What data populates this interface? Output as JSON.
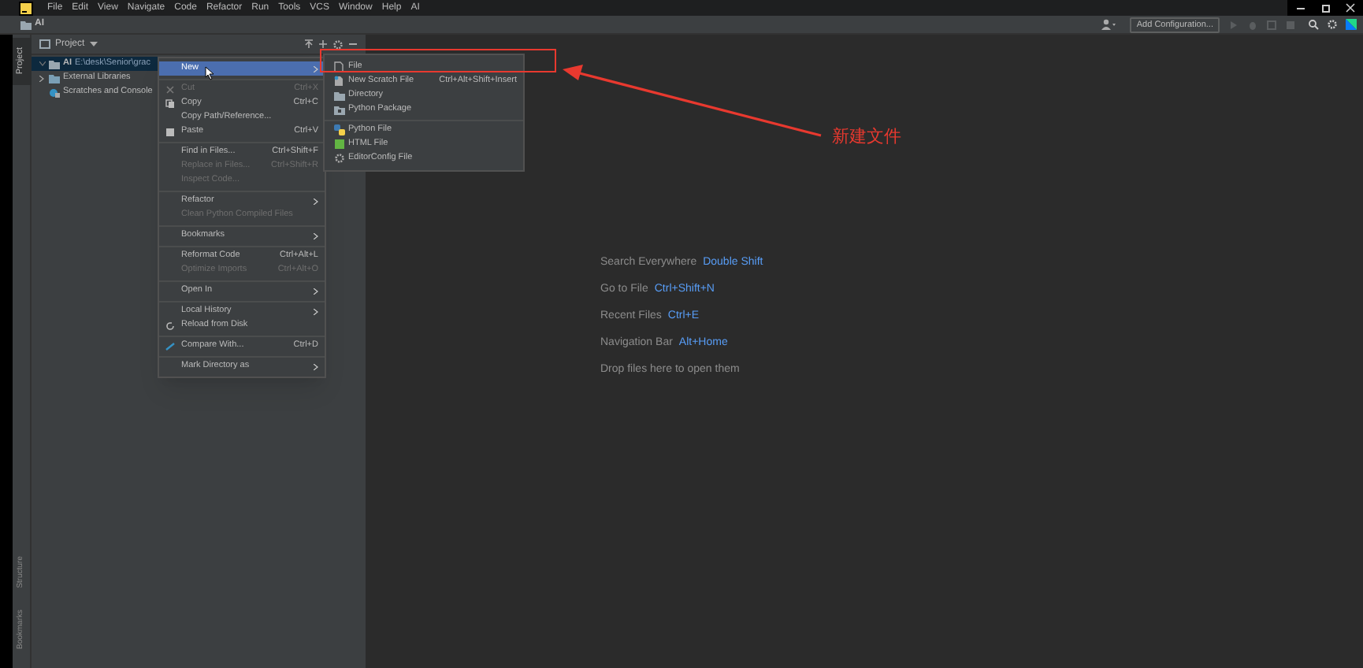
{
  "menu_bar": [
    "File",
    "Edit",
    "View",
    "Navigate",
    "Code",
    "Refactor",
    "Run",
    "Tools",
    "VCS",
    "Window",
    "Help",
    "AI"
  ],
  "navigation_bar": {
    "crumb": "AI"
  },
  "toolbar": {
    "run_configuration": "Add Configuration..."
  },
  "side_tabs": {
    "top": "Project",
    "bottom": [
      "Structure",
      "Bookmarks"
    ]
  },
  "project_panel": {
    "title": "Project",
    "tree": [
      {
        "label": "AI",
        "path": "E:\\desk\\Senior\\grac",
        "selected": true,
        "expanded": true
      },
      {
        "label": "External Libraries",
        "selected": false,
        "expanded": false
      },
      {
        "label": "Scratches and Console",
        "selected": false
      }
    ]
  },
  "context_menu": [
    {
      "kind": "item",
      "label": "New",
      "selected": true,
      "submenu": true,
      "disabled": false
    },
    {
      "kind": "separator"
    },
    {
      "kind": "item",
      "label": "Cut",
      "shortcut": "Ctrl+X",
      "selected": false,
      "disabled": true
    },
    {
      "kind": "item",
      "label": "Copy",
      "shortcut": "Ctrl+C",
      "selected": false,
      "disabled": false
    },
    {
      "kind": "item",
      "label": "Copy Path/Reference...",
      "selected": false,
      "disabled": false
    },
    {
      "kind": "item",
      "label": "Paste",
      "shortcut": "Ctrl+V",
      "selected": false,
      "disabled": false
    },
    {
      "kind": "separator"
    },
    {
      "kind": "item",
      "label": "Find in Files...",
      "shortcut": "Ctrl+Shift+F",
      "selected": false,
      "disabled": false
    },
    {
      "kind": "item",
      "label": "Replace in Files...",
      "shortcut": "Ctrl+Shift+R",
      "selected": false,
      "disabled": true
    },
    {
      "kind": "item",
      "label": "Inspect Code...",
      "selected": false,
      "disabled": true
    },
    {
      "kind": "separator"
    },
    {
      "kind": "item",
      "label": "Refactor",
      "submenu": true,
      "selected": false,
      "disabled": false
    },
    {
      "kind": "item",
      "label": "Clean Python Compiled Files",
      "selected": false,
      "disabled": true
    },
    {
      "kind": "separator"
    },
    {
      "kind": "item",
      "label": "Bookmarks",
      "submenu": true,
      "selected": false,
      "disabled": false
    },
    {
      "kind": "separator"
    },
    {
      "kind": "item",
      "label": "Reformat Code",
      "shortcut": "Ctrl+Alt+L",
      "selected": false,
      "disabled": false
    },
    {
      "kind": "item",
      "label": "Optimize Imports",
      "shortcut": "Ctrl+Alt+O",
      "selected": false,
      "disabled": true
    },
    {
      "kind": "separator"
    },
    {
      "kind": "item",
      "label": "Open In",
      "submenu": true,
      "selected": false,
      "disabled": false
    },
    {
      "kind": "separator"
    },
    {
      "kind": "item",
      "label": "Local History",
      "submenu": true,
      "selected": false,
      "disabled": false
    },
    {
      "kind": "item",
      "label": "Reload from Disk",
      "selected": false,
      "disabled": false
    },
    {
      "kind": "separator"
    },
    {
      "kind": "item",
      "label": "Compare With...",
      "shortcut": "Ctrl+D",
      "selected": false,
      "disabled": false
    },
    {
      "kind": "separator"
    },
    {
      "kind": "item",
      "label": "Mark Directory as",
      "submenu": true,
      "selected": false,
      "disabled": false
    }
  ],
  "new_submenu": [
    {
      "kind": "item",
      "label": "File"
    },
    {
      "kind": "item",
      "label": "New Scratch File",
      "shortcut": "Ctrl+Alt+Shift+Insert"
    },
    {
      "kind": "item",
      "label": "Directory"
    },
    {
      "kind": "item",
      "label": "Python Package"
    },
    {
      "kind": "separator"
    },
    {
      "kind": "item",
      "label": "Python File"
    },
    {
      "kind": "item",
      "label": "HTML File"
    },
    {
      "kind": "item",
      "label": "EditorConfig File"
    }
  ],
  "editor_hints": [
    {
      "label": "Search Everywhere",
      "shortcut": "Double Shift"
    },
    {
      "label": "Go to File",
      "shortcut": "Ctrl+Shift+N"
    },
    {
      "label": "Recent Files",
      "shortcut": "Ctrl+E"
    },
    {
      "label": "Navigation Bar",
      "shortcut": "Alt+Home"
    },
    {
      "label": "Drop files here to open them"
    }
  ],
  "annotation": {
    "text": "新建文件"
  }
}
